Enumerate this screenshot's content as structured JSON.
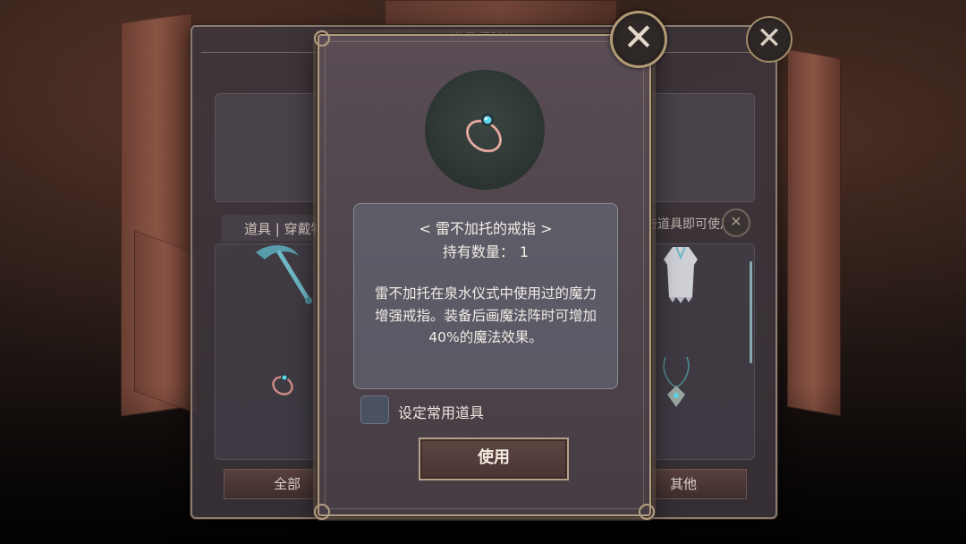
{
  "background_panel": {
    "title": "道具保险箱",
    "tabs_label": "道具 | 穿戴物",
    "hint_text": "点击道具即可使用",
    "bottom_buttons": [
      "全部",
      "其他"
    ],
    "close_icon": "close-x-icon"
  },
  "dialog": {
    "item_name": "< 雷不加托的戒指 >",
    "count_label": "持有数量：",
    "count_value": "1",
    "description": "雷不加托在泉水仪式中使用过的魔力增强戒指。装备后画魔法阵时可增加40%的魔法效果。",
    "checkbox_label": "设定常用道具",
    "checkbox_checked": false,
    "use_button": "使用",
    "close_icon": "close-x-icon",
    "item_icon": "ring-icon"
  },
  "colors": {
    "frame_gold": "#b49e82",
    "dialog_bg": "#4e444b",
    "info_box": "#686e7c",
    "gem_cyan": "#5fd6e8"
  }
}
